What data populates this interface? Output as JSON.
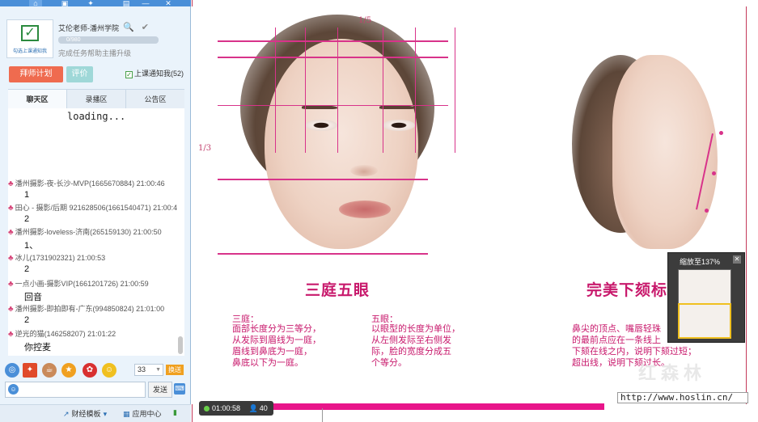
{
  "profile": {
    "badge_caption": "勾选上课通知我",
    "name": "艾伦老师-潘州学院",
    "progress_text": "0/980",
    "progress_tip": "完成任务帮助主播升级"
  },
  "buttons": {
    "plan": "拜师计划",
    "rate": "评价",
    "notify": "上课通知我(52)",
    "send": "发送",
    "send_key": "换送"
  },
  "tabs": [
    "聊天区",
    "录播区",
    "公告区"
  ],
  "chat": {
    "loading": "loading...",
    "messages": [
      {
        "who": "潘州摄影-夜-长沙-MVP(1665670884) 21:00:46",
        "text": "1"
      },
      {
        "who": "田心 - 摄影/后期 921628506(1661540471) 21:00:4",
        "text": "2"
      },
      {
        "who": "潘州摄影-loveless-济南(265159130) 21:00:50",
        "text": "1、"
      },
      {
        "who": "冰儿(1731902321) 21:00:53",
        "text": "2"
      },
      {
        "who": "一点小画-摄影VIP(1661201726) 21:00:59",
        "text": "回音"
      },
      {
        "who": "潘州摄影-即拍即有-广东(994850824) 21:01:00",
        "text": "2"
      },
      {
        "who": "逆光的猫(146258207) 21:01:22",
        "text": "你控麦"
      }
    ]
  },
  "font_size": "33",
  "bottom_links": [
    "财经模板",
    "应用中心"
  ],
  "slide": {
    "frac_top": "1/5",
    "frac_left": "1/3",
    "title_left": "三庭五眼",
    "title_right": "完美下颏标准",
    "sections": [
      {
        "head": "三庭：",
        "lines": [
          "面部长度分为三等分，",
          "从发际到眉线为一庭，",
          "眉线到鼻底为一庭，",
          "鼻底以下为一庭。"
        ]
      },
      {
        "head": "五眼：",
        "lines": [
          "以眼型的长度为单位，",
          "从左侧发际至右侧发",
          "际，脸的宽度分成五",
          "个等分。"
        ]
      },
      {
        "head": "",
        "lines": [
          "鼻尖的顶点、嘴唇轻珠",
          "的最前点应在一条线上",
          "下颏在线之内，说明下颏过短；",
          "超出线，说明下颏过长。"
        ]
      }
    ]
  },
  "zoom": {
    "label": "缩放至137%"
  },
  "timer": {
    "time": "01:00:58",
    "viewers": "40"
  },
  "watermark": {
    "big": "红森林",
    "url": "http://www.hoslin.cn/"
  }
}
